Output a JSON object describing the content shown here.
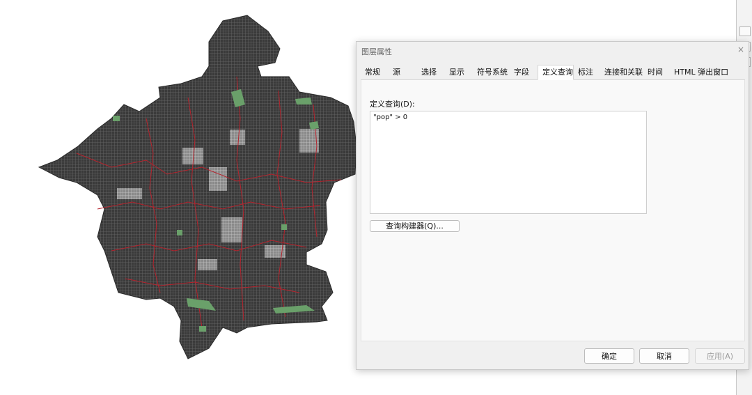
{
  "dialog": {
    "title": "图层属性",
    "close_glyph": "×",
    "tabs": [
      "常规",
      "源",
      "选择",
      "显示",
      "符号系统",
      "字段",
      "定义查询",
      "标注",
      "连接和关联",
      "时间",
      "HTML 弹出窗口"
    ],
    "active_tab": "定义查询",
    "definition_query": {
      "label": "定义查询(D):",
      "value": "\"pop\" > 0",
      "builder_button": "查询构建器(Q)..."
    },
    "buttons": {
      "ok": "确定",
      "cancel": "取消",
      "apply": "应用(A)"
    }
  },
  "map": {
    "fill_color": "#3b3b3b",
    "grid_color": "#6a6a6a",
    "boundary_color": "#b5232d",
    "green_color": "#6aa06a"
  }
}
